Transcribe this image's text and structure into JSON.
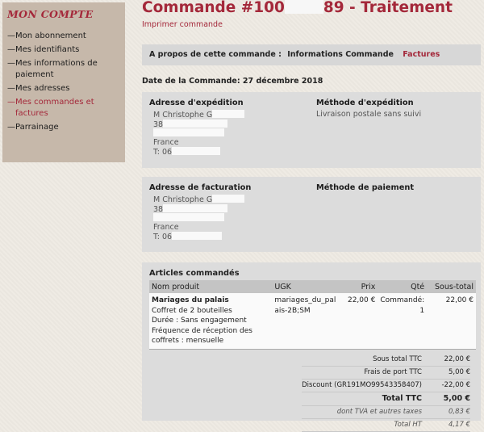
{
  "sidebar": {
    "title": "MON COMPTE",
    "items": [
      {
        "label": "Mon abonnement",
        "active": false
      },
      {
        "label": "Mes identifiants",
        "active": false
      },
      {
        "label": "Mes informations de paiement",
        "active": false
      },
      {
        "label": "Mes adresses",
        "active": false
      },
      {
        "label": "Mes commandes et factures",
        "active": true
      },
      {
        "label": "Parrainage",
        "active": false
      }
    ]
  },
  "order": {
    "title_prefix": "Commande #100",
    "title_suffix": "89 - Traitement",
    "print_label": "Imprimer commande",
    "about_label": "A propos de cette commande :",
    "info_label": "Informations Commande",
    "invoices_label": "Factures",
    "date_line": "Date de la Commande: 27 décembre 2018"
  },
  "shipping": {
    "address_title": "Adresse d'expédition",
    "name": "M Christophe G",
    "street": "38",
    "country": "France",
    "phone": "T: 06",
    "method_title": "Méthode d'expédition",
    "method_value": "Livraison postale sans suivi"
  },
  "billing": {
    "address_title": "Adresse de facturation",
    "name": "M Christophe G",
    "street": "38",
    "country": "France",
    "phone": "T: 06",
    "method_title": "Méthode de paiement"
  },
  "items": {
    "title": "Articles commandés",
    "headers": {
      "name": "Nom produit",
      "sku": "UGK",
      "price": "Prix",
      "qty": "Qté",
      "subtotal": "Sous-total"
    },
    "rows": [
      {
        "name": "Mariages du palais",
        "lines": [
          "Coffret de 2 bouteilles",
          "Durée : Sans engagement",
          "Fréquence de réception des coffrets : mensuelle"
        ],
        "sku": "mariages_du_palais-2B;SM",
        "price": "22,00 €",
        "qty_label": "Commandé:",
        "qty_value": "1",
        "subtotal": "22,00 €"
      }
    ]
  },
  "totals": {
    "subtotal_label": "Sous total TTC",
    "subtotal_value": "22,00 €",
    "shipping_label": "Frais de port TTC",
    "shipping_value": "5,00 €",
    "discount_label": "Discount (GR191MO99543358407)",
    "discount_value": "-22,00 €",
    "total_label": "Total TTC",
    "total_value": "5,00 €",
    "tax_label": "dont TVA et autres taxes",
    "tax_value": "0,83 €",
    "ht_label": "Total HT",
    "ht_value": "4,17 €"
  },
  "colors": {
    "accent": "#a4283a",
    "sidebar_bg": "#c6b8aa",
    "panel_bg": "#dcdcdc"
  }
}
